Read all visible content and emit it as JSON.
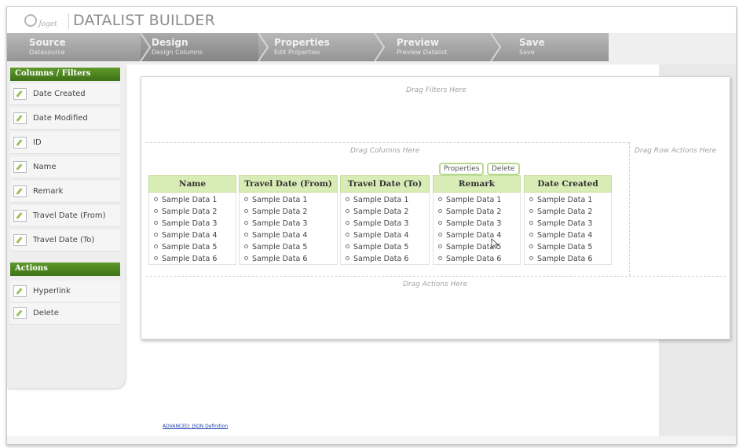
{
  "header": {
    "logo_text": "Joget",
    "title": "DATALIST BUILDER"
  },
  "steps": [
    {
      "label": "Source",
      "sub": "Datasource"
    },
    {
      "label": "Design",
      "sub": "Design Columns"
    },
    {
      "label": "Properties",
      "sub": "Edit Properties"
    },
    {
      "label": "Preview",
      "sub": "Preview Datalist"
    },
    {
      "label": "Save",
      "sub": "Save"
    }
  ],
  "sidebar": {
    "columns_heading": "Columns / Filters",
    "columns": [
      {
        "label": "Date Created"
      },
      {
        "label": "Date Modified"
      },
      {
        "label": "ID"
      },
      {
        "label": "Name"
      },
      {
        "label": "Remark"
      },
      {
        "label": "Travel Date (From)"
      },
      {
        "label": "Travel Date (To)"
      }
    ],
    "actions_heading": "Actions",
    "actions": [
      {
        "label": "Hyperlink"
      },
      {
        "label": "Delete"
      }
    ]
  },
  "builder": {
    "drag_filters": "Drag Filters Here",
    "drag_columns": "Drag Columns Here",
    "drag_row_actions": "Drag Row Actions Here",
    "drag_actions": "Drag Actions Here",
    "properties_button": "Properties",
    "delete_button": "Delete",
    "columns": [
      {
        "header": "Name",
        "cells": [
          "Sample Data 1",
          "Sample Data 2",
          "Sample Data 3",
          "Sample Data 4",
          "Sample Data 5",
          "Sample Data 6"
        ]
      },
      {
        "header": "Travel Date (From)",
        "cells": [
          "Sample Data 1",
          "Sample Data 2",
          "Sample Data 3",
          "Sample Data 4",
          "Sample Data 5",
          "Sample Data 6"
        ]
      },
      {
        "header": "Travel Date (To)",
        "cells": [
          "Sample Data 1",
          "Sample Data 2",
          "Sample Data 3",
          "Sample Data 4",
          "Sample Data 5",
          "Sample Data 6"
        ]
      },
      {
        "header": "Remark",
        "cells": [
          "Sample Data 1",
          "Sample Data 2",
          "Sample Data 3",
          "Sample Data 4",
          "Sample Data 5",
          "Sample Data 6"
        ]
      },
      {
        "header": "Date Created",
        "cells": [
          "Sample Data 1",
          "Sample Data 2",
          "Sample Data 3",
          "Sample Data 4",
          "Sample Data 5",
          "Sample Data 6"
        ]
      }
    ]
  },
  "footer": {
    "advanced_link": "ADVANCED: JSON Definition"
  },
  "colors": {
    "accent_green": "#3d7216",
    "header_green": "#d8ecb6",
    "step_gray": "#a3a3a3"
  }
}
